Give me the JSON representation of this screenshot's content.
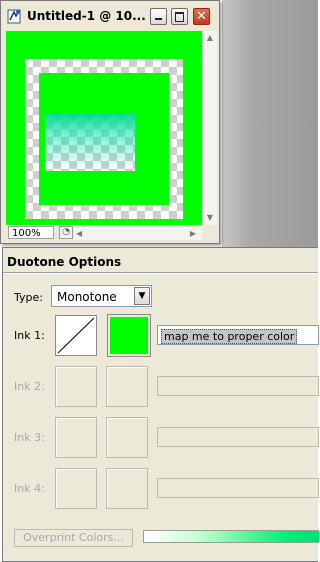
{
  "image_window": {
    "title": "Untitled-1 @ 10...",
    "zoom": "100%",
    "colors": {
      "canvas": "#00ff00",
      "gradient": "#00e08c"
    }
  },
  "duotone": {
    "title": "Duotone Options",
    "type_label": "Type:",
    "type_value": "Monotone",
    "inks": [
      {
        "label": "Ink 1:",
        "name": "map me to proper color",
        "color": "#00ff00",
        "enabled": true
      },
      {
        "label": "Ink 2:",
        "name": "",
        "enabled": false
      },
      {
        "label": "Ink 3:",
        "name": "",
        "enabled": false
      },
      {
        "label": "Ink 4:",
        "name": "",
        "enabled": false
      }
    ],
    "overprint_label": "Overprint Colors..."
  }
}
